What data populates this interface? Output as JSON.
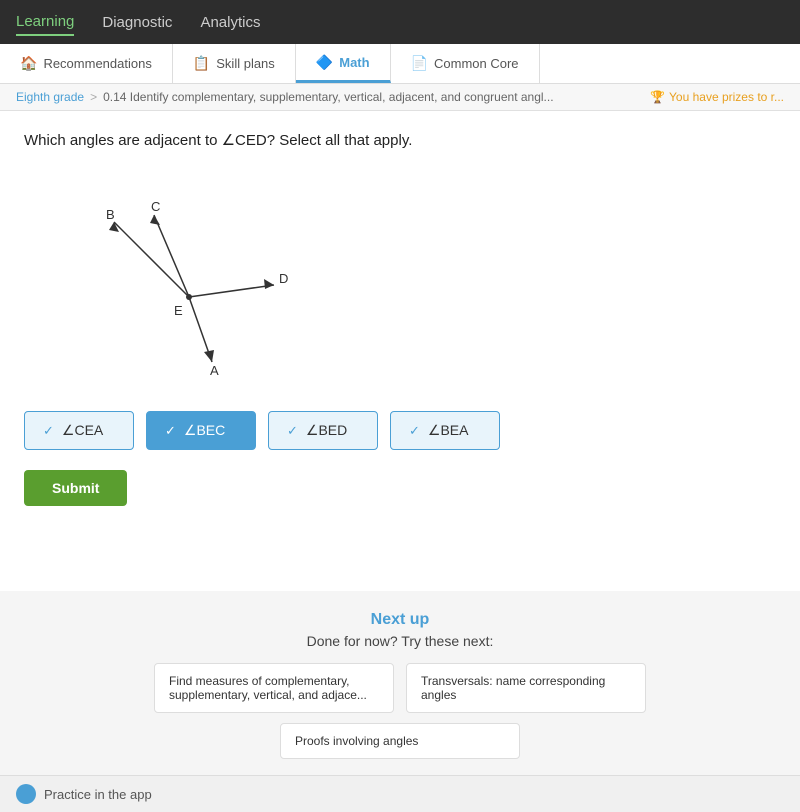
{
  "topNav": {
    "items": [
      {
        "id": "learning",
        "label": "Learning",
        "active": true
      },
      {
        "id": "diagnostic",
        "label": "Diagnostic",
        "active": false
      },
      {
        "id": "analytics",
        "label": "Analytics",
        "active": false
      }
    ]
  },
  "tabs": [
    {
      "id": "recommendations",
      "label": "Recommendations",
      "icon": "🏠",
      "active": false
    },
    {
      "id": "skill-plans",
      "label": "Skill plans",
      "icon": "📋",
      "active": false
    },
    {
      "id": "math",
      "label": "Math",
      "icon": "🔷",
      "active": true
    },
    {
      "id": "common-core",
      "label": "Common Core",
      "icon": "📄",
      "active": false
    }
  ],
  "breadcrumb": {
    "grade": "Eighth grade",
    "separator": ">",
    "skill": "0.14 Identify complementary, supplementary, vertical, adjacent, and congruent angl...",
    "prize": "You have prizes to r..."
  },
  "question": {
    "text": "Which angles are adjacent to ∠CED? Select all that apply."
  },
  "choices": [
    {
      "id": "cea",
      "label": "∠CEA",
      "checked": true,
      "selected": false
    },
    {
      "id": "bec",
      "label": "∠BEC",
      "checked": true,
      "selected": true
    },
    {
      "id": "bed",
      "label": "∠BED",
      "checked": true,
      "selected": false
    },
    {
      "id": "bea",
      "label": "∠BEA",
      "checked": true,
      "selected": false
    }
  ],
  "submitButton": {
    "label": "Submit"
  },
  "nextUp": {
    "title": "Next up",
    "subtitle": "Done for now? Try these next:",
    "cards": [
      {
        "label": "Find measures of complementary, supplementary, vertical, and adjace..."
      },
      {
        "label": "Transversals: name corresponding angles"
      }
    ],
    "bottomCard": {
      "label": "Proofs involving angles"
    }
  },
  "bottomBar": {
    "label": "Practice in the app"
  }
}
